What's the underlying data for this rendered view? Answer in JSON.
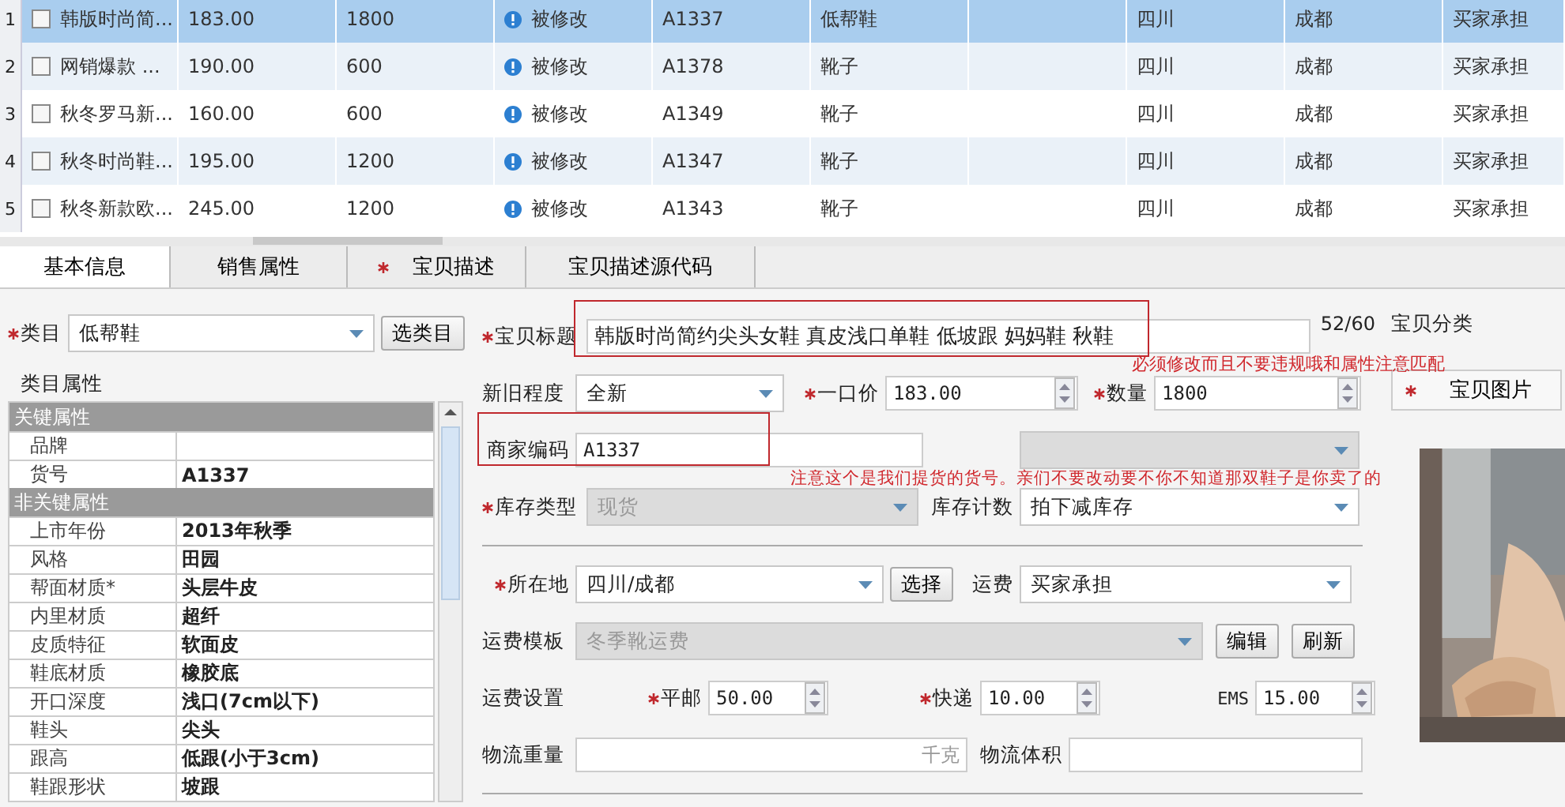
{
  "grid": {
    "rows": [
      {
        "number": "1",
        "checked": false,
        "selected": true,
        "title": "韩版时尚简...",
        "price": "183.00",
        "quantity": "1800",
        "status": "被修改",
        "code": "A1337",
        "category": "低帮鞋",
        "province": "四川",
        "city": "成都",
        "shipping": "买家承担"
      },
      {
        "number": "2",
        "checked": false,
        "selected": false,
        "title": "网销爆款 ...",
        "price": "190.00",
        "quantity": "600",
        "status": "被修改",
        "code": "A1378",
        "category": "靴子",
        "province": "四川",
        "city": "成都",
        "shipping": "买家承担"
      },
      {
        "number": "3",
        "checked": false,
        "selected": false,
        "title": "秋冬罗马新...",
        "price": "160.00",
        "quantity": "600",
        "status": "被修改",
        "code": "A1349",
        "category": "靴子",
        "province": "四川",
        "city": "成都",
        "shipping": "买家承担"
      },
      {
        "number": "4",
        "checked": false,
        "selected": false,
        "title": "秋冬时尚鞋...",
        "price": "195.00",
        "quantity": "1200",
        "status": "被修改",
        "code": "A1347",
        "category": "靴子",
        "province": "四川",
        "city": "成都",
        "shipping": "买家承担"
      },
      {
        "number": "5",
        "checked": false,
        "selected": false,
        "title": "秋冬新款欧...",
        "price": "245.00",
        "quantity": "1200",
        "status": "被修改",
        "code": "A1343",
        "category": "靴子",
        "province": "四川",
        "city": "成都",
        "shipping": "买家承担"
      }
    ]
  },
  "tabs": [
    {
      "label": "基本信息",
      "selected": true,
      "required": false
    },
    {
      "label": "销售属性",
      "selected": false,
      "required": false
    },
    {
      "label": "宝贝描述",
      "selected": false,
      "required": true
    },
    {
      "label": "宝贝描述源代码",
      "selected": false,
      "required": false
    }
  ],
  "basic": {
    "category": {
      "label": "类目",
      "required": true,
      "value": "低帮鞋",
      "button": "选类目"
    },
    "properties": {
      "legend": "类目属性",
      "groups": [
        {
          "label": "关键属性",
          "items": [
            {
              "name": "品牌"
            },
            {
              "name": "货号",
              "value": "A1337"
            }
          ]
        },
        {
          "label": "非关键属性",
          "items": [
            {
              "name": "上市年份",
              "value": "2013年秋季"
            },
            {
              "name": "风格",
              "value": "田园"
            },
            {
              "name": "帮面材质*",
              "value": "头层牛皮"
            },
            {
              "name": "内里材质",
              "value": "超纤"
            },
            {
              "name": "皮质特征",
              "value": "软面皮"
            },
            {
              "name": "鞋底材质",
              "value": "橡胶底"
            },
            {
              "name": "开口深度",
              "value": "浅口(7cm以下)"
            },
            {
              "name": "鞋头",
              "value": "尖头"
            },
            {
              "name": "跟高",
              "value": "低跟(小于3cm)"
            },
            {
              "name": "鞋跟形状",
              "value": "坡跟"
            }
          ]
        }
      ]
    },
    "title": {
      "label": "宝贝标题",
      "required": true,
      "value": "韩版时尚简约尖头女鞋 真皮浅口单鞋 低坡跟 妈妈鞋 秋鞋",
      "counter": "52/60"
    },
    "condition": {
      "label": "新旧程度",
      "required": false,
      "value": "全新"
    },
    "price": {
      "label": "一口价",
      "required": true,
      "value": "183.00"
    },
    "quantity": {
      "label": "数量",
      "required": true,
      "value": "1800"
    },
    "merchant_code": {
      "label": "商家编码",
      "value": "A1337"
    },
    "stock_type": {
      "label": "库存类型",
      "required": true,
      "value": "现货",
      "disabled": true
    },
    "stock_count": {
      "label": "库存计数",
      "value": "拍下减库存",
      "disabled": false
    },
    "location": {
      "label": "所在地",
      "required": true,
      "value": "四川/成都",
      "button": "选择"
    },
    "freight": {
      "label": "运费",
      "value": "买家承担",
      "disabled": false
    },
    "freight_template": {
      "label": "运费模板",
      "value": "冬季靴运费",
      "disabled": true,
      "buttons": [
        "编辑",
        "刷新"
      ]
    },
    "freight_settings": {
      "label": "运费设置",
      "rates": [
        {
          "label": "平邮",
          "required": true,
          "value": "50.00"
        },
        {
          "label": "快递",
          "required": true,
          "value": "10.00"
        },
        {
          "label": "EMS",
          "required": false,
          "value": "15.00"
        }
      ]
    },
    "weight": {
      "label": "物流重量",
      "unit": "千克"
    },
    "volume": {
      "label": "物流体积"
    },
    "item_category": {
      "label": "宝贝分类"
    },
    "image_tab": {
      "label": "宝贝图片",
      "required": true
    }
  },
  "annotations": [
    {
      "text": "必须修改而且不要违规哦和属性注意匹配"
    },
    {
      "text": "注意这个是我们提货的货号。亲们不要改动要不你不知道那双鞋子是你卖了的"
    }
  ]
}
